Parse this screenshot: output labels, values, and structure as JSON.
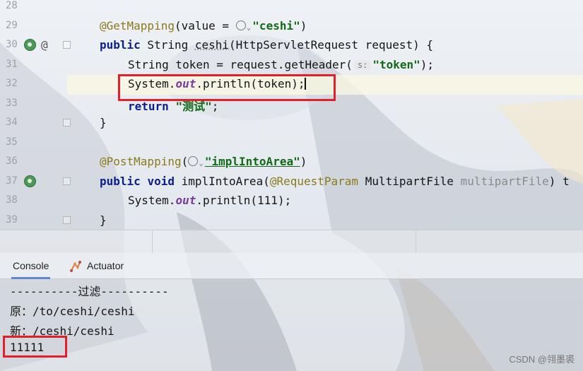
{
  "editor": {
    "lines": [
      {
        "num": "28"
      },
      {
        "num": "29",
        "annotation": "@GetMapping",
        "value_kw": "value = ",
        "value": "\"ceshi\""
      },
      {
        "num": "30",
        "public": "public",
        "rest": " String ",
        "method": "ceshi",
        "params": "(HttpServletRequest request) {"
      },
      {
        "num": "31",
        "left": "String token = request.getHeader(",
        "hint": "s:",
        "str": "\"token\"",
        "end": ");"
      },
      {
        "num": "32",
        "left": "System.",
        "field": "out",
        "right": ".println(token);"
      },
      {
        "num": "33",
        "kw": "return",
        "str": "\"测试\"",
        "end": ";"
      },
      {
        "num": "34",
        "text": "}"
      },
      {
        "num": "35"
      },
      {
        "num": "36",
        "annotation": "@PostMapping",
        "str": "\"implIntoArea\"",
        "end": ")"
      },
      {
        "num": "37",
        "kw1": "public",
        "kw2": "void",
        "method": " implIntoArea(",
        "anno": "@RequestParam",
        "type": " MultipartFile ",
        "param": "multipartFile",
        "end": ") t"
      },
      {
        "num": "38",
        "left": "System.",
        "field": "out",
        "right": ".println(111);"
      },
      {
        "num": "39",
        "text": "}"
      }
    ]
  },
  "bottom_tabs": [
    {
      "label": "Console",
      "active": true
    },
    {
      "label": "Actuator",
      "active": false
    }
  ],
  "console": {
    "lines": [
      "----------过滤----------",
      "原：/to/ceshi/ceshi",
      "新：/ceshi/ceshi",
      "11111"
    ]
  },
  "watermark": "CSDN @翎墨裘",
  "colors": {
    "highlight_box": "#e2202a",
    "current_line": "#fcfae0"
  }
}
